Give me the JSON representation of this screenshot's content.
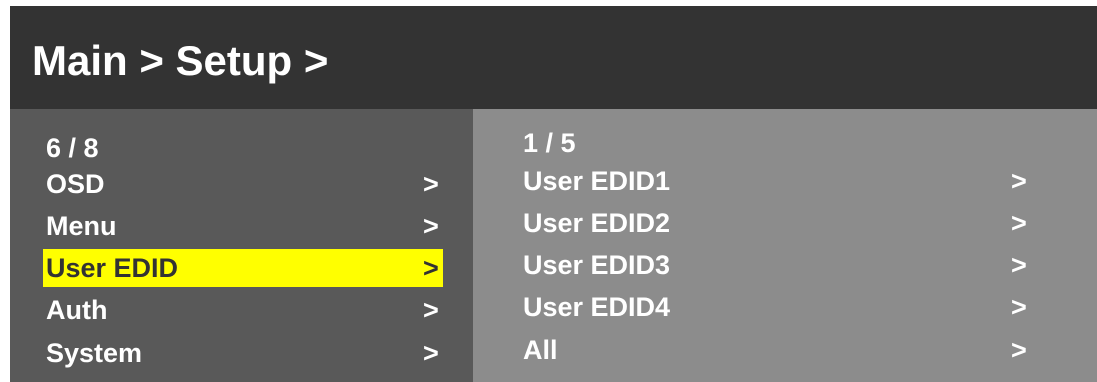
{
  "header": {
    "breadcrumb": "Main > Setup >"
  },
  "left_panel": {
    "counter": "6 / 8",
    "items": [
      {
        "label": "OSD",
        "arrow": ">"
      },
      {
        "label": "Menu",
        "arrow": ">"
      },
      {
        "label": "User EDID",
        "arrow": ">",
        "selected": true
      },
      {
        "label": "Auth",
        "arrow": ">"
      },
      {
        "label": "System",
        "arrow": ">"
      }
    ]
  },
  "right_panel": {
    "counter": "1 / 5",
    "items": [
      {
        "label": "User EDID1",
        "arrow": ">"
      },
      {
        "label": "User EDID2",
        "arrow": ">"
      },
      {
        "label": "User EDID3",
        "arrow": ">"
      },
      {
        "label": "User EDID4",
        "arrow": ">"
      },
      {
        "label": "All",
        "arrow": ">"
      }
    ]
  },
  "colors": {
    "header_bg": "#333333",
    "left_panel_bg": "#595959",
    "right_panel_bg": "#8c8c8c",
    "highlight": "#ffff00",
    "text": "#ffffff"
  }
}
